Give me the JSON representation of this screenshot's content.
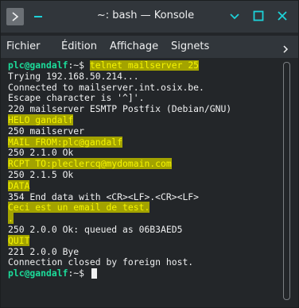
{
  "window": {
    "title": "~: bash — Konsole"
  },
  "menu": {
    "items": [
      "Fichier",
      "Édition",
      "Affichage",
      "Signets"
    ]
  },
  "terminal": {
    "prompt_user": "plc@gandalf",
    "prompt_sep": ":~$ ",
    "lines": {
      "l0_cmd": "telnet mailserver 25",
      "l1": "Trying 192.168.50.214...",
      "l2": "Connected to mailserver.int.osix.be.",
      "l3": "Escape character is '^]'.",
      "l4": "220 mailserver ESMTP Postfix (Debian/GNU)",
      "l5": "HELO gandalf",
      "l6": "250 mailserver",
      "l7": "MAIL FROM:plc@gandalf",
      "l8": "250 2.1.0 Ok",
      "l9": "RCPT TO:pleclercq@mydomain.com",
      "l10": "250 2.1.5 Ok",
      "l11": "DATA",
      "l12": "354 End data with <CR><LF>.<CR><LF>",
      "l13": "Ceci est un email de test.",
      "l14": ".",
      "l15": "250 2.0.0 Ok: queued as 06B3AED5",
      "l16": "QUIT",
      "l17": "221 2.0.0 Bye",
      "l18": "Connection closed by foreign host."
    }
  },
  "colors": {
    "prompt": "#1cdc9a",
    "highlight_bg": "#a3a300",
    "highlight_fg": "#f4f400",
    "accent": "#1dd2d9"
  },
  "icons": {
    "app": "terminal-icon",
    "minimize": "minimize-icon",
    "maximize": "maximize-icon",
    "close": "close-icon",
    "menu_overflow": "chevron-right-icon"
  }
}
